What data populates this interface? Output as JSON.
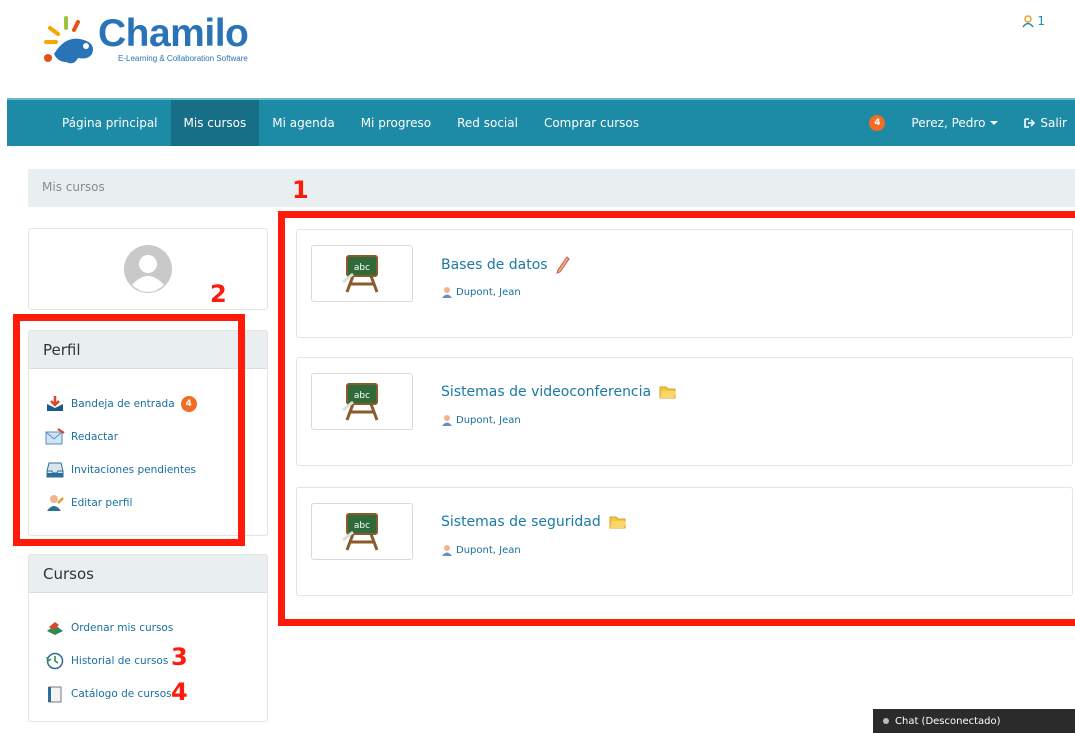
{
  "brand": {
    "name": "Chamilo",
    "tagline": "E-Learning & Collaboration Software"
  },
  "header": {
    "online_users": "1"
  },
  "navbar": {
    "items": [
      {
        "label": "Página principal"
      },
      {
        "label": "Mis cursos"
      },
      {
        "label": "Mi agenda"
      },
      {
        "label": "Mi progreso"
      },
      {
        "label": "Red social"
      },
      {
        "label": "Comprar cursos"
      }
    ],
    "notifications": "4",
    "user": "Perez, Pedro",
    "logout": "Salir"
  },
  "breadcrumb": "Mis cursos",
  "perfil": {
    "title": "Perfil",
    "items": [
      {
        "label": "Bandeja de entrada",
        "badge": "4"
      },
      {
        "label": "Redactar"
      },
      {
        "label": "Invitaciones pendientes"
      },
      {
        "label": "Editar perfil"
      }
    ]
  },
  "cursos": {
    "title": "Cursos",
    "items": [
      {
        "label": "Ordenar mis cursos"
      },
      {
        "label": "Historial de cursos"
      },
      {
        "label": "Catálogo de cursos"
      }
    ]
  },
  "courses": [
    {
      "title": "Bases de datos",
      "teacher": "Dupont, Jean"
    },
    {
      "title": "Sistemas de videoconferencia",
      "teacher": "Dupont, Jean"
    },
    {
      "title": "Sistemas de seguridad",
      "teacher": "Dupont, Jean"
    }
  ],
  "annotations": [
    "1",
    "2",
    "3",
    "4"
  ],
  "chat": {
    "status": "Chat (Desconectado)"
  },
  "colors": {
    "nav": "#1d8aa6",
    "nav_active": "#166f87",
    "link": "#1a7aa5",
    "badge": "#f26d21",
    "annotation": "#ff1a0a"
  }
}
